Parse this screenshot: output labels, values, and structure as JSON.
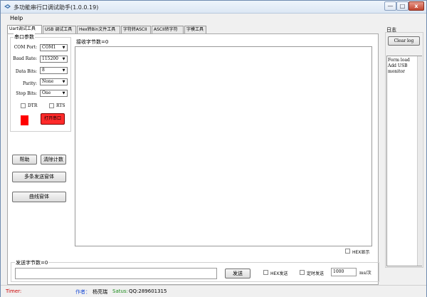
{
  "window": {
    "title": "多功能串行口调试助手(1.0.0.19)",
    "min_glyph": "—",
    "max_glyph": "□",
    "close_glyph": "x"
  },
  "menu": {
    "help": "Help"
  },
  "tabs": [
    {
      "label": "Uart调试工具",
      "active": true
    },
    {
      "label": "USB 调试工具"
    },
    {
      "label": "Hex转Bin文件工具"
    },
    {
      "label": "字符转ASCII"
    },
    {
      "label": "ASCII转字符"
    },
    {
      "label": "字模工具"
    }
  ],
  "serial": {
    "group_label": "串口参数",
    "com_port": {
      "label": "COM Port:",
      "value": "COM1"
    },
    "baud_rate": {
      "label": "Baud Rate:",
      "value": "115200"
    },
    "data_bits": {
      "label": "Data Bits:",
      "value": "8"
    },
    "parity": {
      "label": "Parity:",
      "value": "None"
    },
    "stop_bits": {
      "label": "Stop Bits:",
      "value": "One"
    },
    "dtr": "DTR",
    "rts": "RTS",
    "open_button": "打开串口",
    "indicator_color": "#ff0000"
  },
  "buttons": {
    "help": "帮助",
    "clear_count": "清除计数",
    "multi_send": "多条发送窗体",
    "curve_window": "曲线窗体"
  },
  "receive": {
    "count_label": "接收字节数=0",
    "hex_display": "HEX显示"
  },
  "send": {
    "count_label": "发送字节数=0",
    "send_button": "发送",
    "hex_send": "HEX发送",
    "timed_send": "定时发送",
    "interval_value": "1000",
    "interval_unit": "ms/次"
  },
  "log": {
    "label": "日志",
    "clear_button": "Clear log",
    "lines": [
      "Form load",
      "Add USB",
      "monitor"
    ]
  },
  "status": {
    "timer": "Timer:",
    "author_label": "作者：",
    "author_name": "杨亮瑞",
    "status_label": "Satus:",
    "qq": "QQ:289601315"
  },
  "colors": {
    "timer_text": "#cc0000",
    "author_label": "#1f4fd6",
    "status_label": "#1a8a1a",
    "red_indicator": "#ff0000"
  },
  "icons": {
    "app": "app-icon"
  }
}
